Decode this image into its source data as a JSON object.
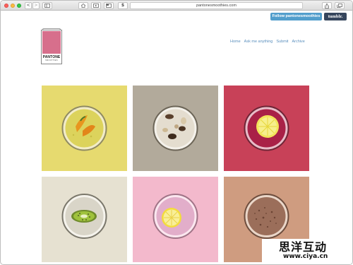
{
  "browser": {
    "url": "pantonesmoothies.com",
    "buttons": {
      "back": "<",
      "forward": ">",
      "dollar": "$"
    }
  },
  "header": {
    "follow_button": "Follow pantonesmoothies",
    "tumblr_button": "tumblr."
  },
  "logo": {
    "brand": "PANTONE",
    "subtitle": "SMOOTHIES"
  },
  "nav": {
    "items": [
      "Home",
      "Ask me anything",
      "Submit",
      "Archive"
    ]
  },
  "tiles": [
    {
      "name": "mango-smoothie",
      "background": "#e6da6f",
      "drink": "#dcd35c",
      "fruit": "mango-slices-icon"
    },
    {
      "name": "cookie-smoothie",
      "background": "#b2aa9b",
      "drink": "#e4ddcf",
      "fruit": "cookie-pieces-icon"
    },
    {
      "name": "berry-lemon-smoothie",
      "background": "#c84158",
      "drink": "#a92147",
      "fruit": "lemon-slice-icon"
    },
    {
      "name": "kiwi-smoothie",
      "background": "#e6e1d1",
      "drink": "#d9d5c8",
      "fruit": "kiwi-slice-icon"
    },
    {
      "name": "pink-lemon-smoothie",
      "background": "#f3b9cc",
      "drink": "#e2aeca",
      "fruit": "lemon-slice-icon"
    },
    {
      "name": "chocolate-smoothie",
      "background": "#cf9c80",
      "drink": "#9b6e5a",
      "fruit": "cocoa-powder-icon"
    }
  ],
  "watermark": {
    "chinese": "思洋互动",
    "url": "www.ciya.cn"
  }
}
